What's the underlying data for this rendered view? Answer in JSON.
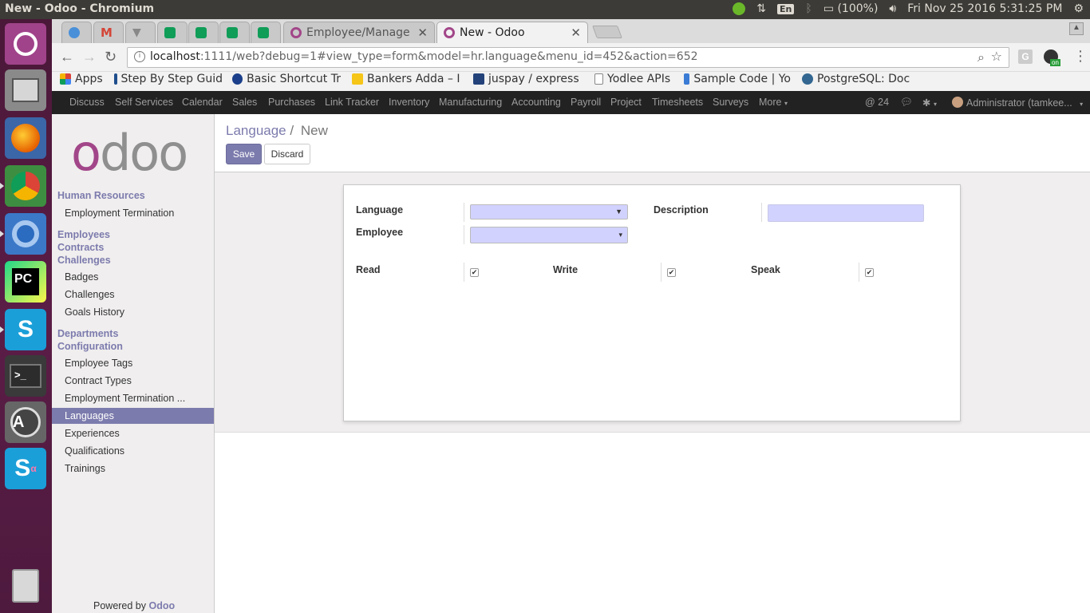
{
  "os": {
    "window_title": "New - Odoo - Chromium",
    "keyboard_layout": "En",
    "battery": "(100%)",
    "datetime": "Fri Nov 25 2016  5:31:25 PM"
  },
  "browser": {
    "tabs": [
      {
        "label": "Employee/Manager",
        "icon": "odoo-icon"
      },
      {
        "label": "New - Odoo",
        "icon": "odoo-icon",
        "active": true
      }
    ],
    "url_host": "localhost",
    "url_rest": ":1111/web?debug=1#view_type=form&model=hr.language&menu_id=452&action=652",
    "extension_badge": "on",
    "bookmarks": [
      {
        "label": "Apps"
      },
      {
        "label": "Step By Step Guid"
      },
      {
        "label": "Basic Shortcut Tr"
      },
      {
        "label": "Bankers Adda – I"
      },
      {
        "label": "juspay / express"
      },
      {
        "label": "Yodlee APIs"
      },
      {
        "label": "Sample Code | Yo"
      },
      {
        "label": "PostgreSQL: Doc"
      }
    ]
  },
  "odoo_nav": {
    "menus": [
      "Discuss",
      "Self Services",
      "Calendar",
      "Sales",
      "Purchases",
      "Link Tracker",
      "Inventory",
      "Manufacturing",
      "Accounting",
      "Payroll",
      "Project",
      "Timesheets",
      "Surveys",
      "More"
    ],
    "messages_count": "24",
    "user": "Administrator (tamkee..."
  },
  "sidebar": {
    "logo": {
      "first": "o",
      "rest": "doo"
    },
    "sections": [
      {
        "header": "Human Resources",
        "items": [
          "Employment Termination"
        ]
      },
      {
        "header": "Employees"
      },
      {
        "header": "Contracts"
      },
      {
        "header": "Challenges",
        "items": [
          "Badges",
          "Challenges",
          "Goals History"
        ]
      },
      {
        "header": "Departments"
      },
      {
        "header": "Configuration",
        "items": [
          "Employee Tags",
          "Contract Types",
          "Employment Termination ...",
          "Languages",
          "Experiences",
          "Qualifications",
          "Trainings"
        ]
      }
    ],
    "active_item": "Languages",
    "powered_by": "Powered by",
    "powered_brand": "Odoo"
  },
  "main": {
    "breadcrumb_parent": "Language",
    "breadcrumb_sep": "/",
    "breadcrumb_current": "New",
    "save_label": "Save",
    "discard_label": "Discard",
    "form": {
      "language_label": "Language",
      "language_value": "",
      "employee_label": "Employee",
      "employee_value": "",
      "description_label": "Description",
      "description_value": "",
      "read_label": "Read",
      "read_checked": true,
      "write_label": "Write",
      "write_checked": true,
      "speak_label": "Speak",
      "speak_checked": true
    }
  },
  "colors": {
    "accent": "#7c7bad",
    "brand_odoo": "#a24689",
    "field_required_bg": "#d2d2ff",
    "nav_bg": "#222222"
  }
}
